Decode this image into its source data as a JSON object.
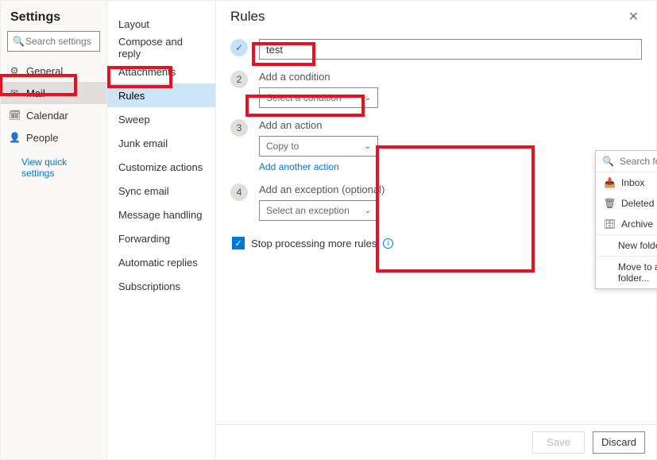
{
  "settings": {
    "title": "Settings",
    "search_placeholder": "Search settings",
    "nav": [
      {
        "label": "General",
        "icon": "⚙"
      },
      {
        "label": "Mail",
        "icon": "✉"
      },
      {
        "label": "Calendar",
        "icon": "📅"
      },
      {
        "label": "People",
        "icon": "👥"
      }
    ],
    "quick_link": "View quick settings"
  },
  "sub": {
    "items": [
      "Layout",
      "Compose and reply",
      "Attachments",
      "Rules",
      "Sweep",
      "Junk email",
      "Customize actions",
      "Sync email",
      "Message handling",
      "Forwarding",
      "Automatic replies",
      "Subscriptions"
    ]
  },
  "main": {
    "title": "Rules",
    "close_aria": "Close",
    "steps": {
      "s1_value": "test",
      "s2_label": "Add a condition",
      "s2_placeholder": "Select a condition",
      "s3_label": "Add an action",
      "s3_value": "Copy to",
      "s3_add_another": "Add another action",
      "s4_label": "Add an exception (optional)",
      "s4_placeholder": "Select an exception"
    },
    "stop_label": "Stop processing more rules",
    "folder_pop": {
      "search_placeholder": "Search for a folder",
      "items": [
        "Inbox",
        "Deleted Items",
        "Archive"
      ],
      "new_folder": "New folder",
      "move_other": "Move to a different folder..."
    },
    "footer": {
      "save": "Save",
      "discard": "Discard"
    }
  }
}
